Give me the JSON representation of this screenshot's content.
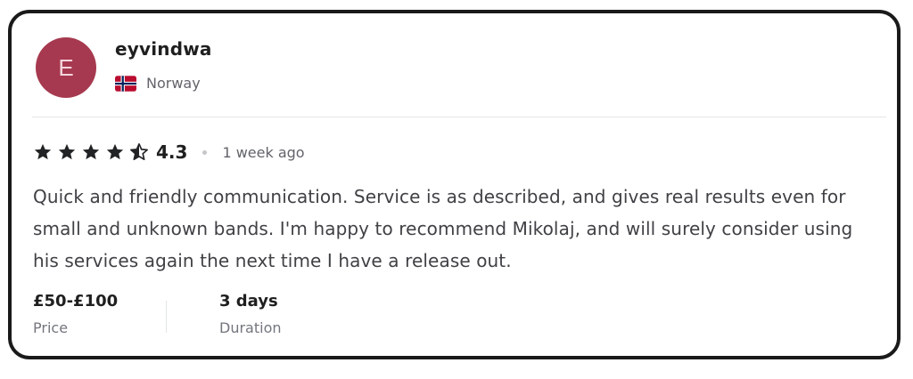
{
  "reviewer": {
    "avatar_initial": "E",
    "avatar_color": "#a6394f",
    "username": "eyvindwa",
    "country": "Norway",
    "flag_icon": "norway-flag-icon"
  },
  "review": {
    "rating": "4.3",
    "rating_value": 4.3,
    "stars_max": 5,
    "time_ago": "1 week ago",
    "text": "Quick and friendly communication. Service is as described, and gives real results even for small and unknown bands. I'm happy to recommend Mikolaj, and will surely consider using his services again the next time I have a release out."
  },
  "meta": {
    "price_value": "£50-£100",
    "price_label": "Price",
    "duration_value": "3 days",
    "duration_label": "Duration"
  }
}
